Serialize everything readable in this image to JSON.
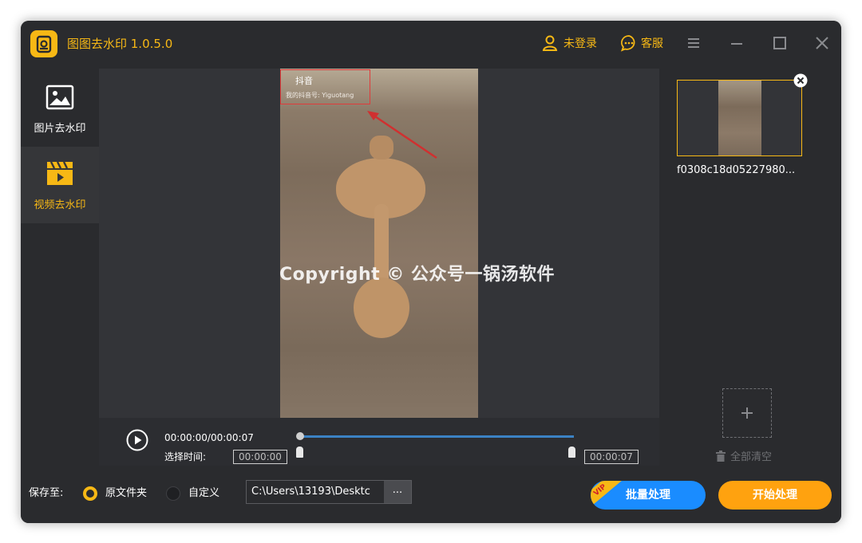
{
  "app": {
    "title": "图图去水印 1.0.5.0"
  },
  "header": {
    "login_label": "未登录",
    "service_label": "客服"
  },
  "sidebar": {
    "items": [
      {
        "label": "图片去水印",
        "icon": "image-icon"
      },
      {
        "label": "视频去水印",
        "icon": "clapperboard-icon"
      }
    ]
  },
  "preview": {
    "watermark_logo_text": "抖音",
    "watermark_id_text": "我的抖音号: Yiguotang",
    "copyright_text": "Copyright © 公众号一锅汤软件"
  },
  "controls": {
    "time_display": "00:00:00/00:00:07",
    "select_time_label": "选择时间:",
    "start_time": "00:00:00",
    "end_time": "00:00:07"
  },
  "files": [
    {
      "name": "f0308c18d05227980..."
    }
  ],
  "right_panel": {
    "clear_all_label": "全部清空"
  },
  "bottom": {
    "save_to_label": "保存至:",
    "option_original": "原文件夹",
    "option_custom": "自定义",
    "output_path": "C:\\Users\\13193\\Desktc",
    "browse_label": "...",
    "vip_badge": "VIP",
    "batch_button": "批量处理",
    "start_button": "开始处理"
  },
  "colors": {
    "accent": "#f7b815",
    "window_bg": "#2a2b2e",
    "blue": "#1a8cff",
    "orange": "#ffa20f"
  }
}
